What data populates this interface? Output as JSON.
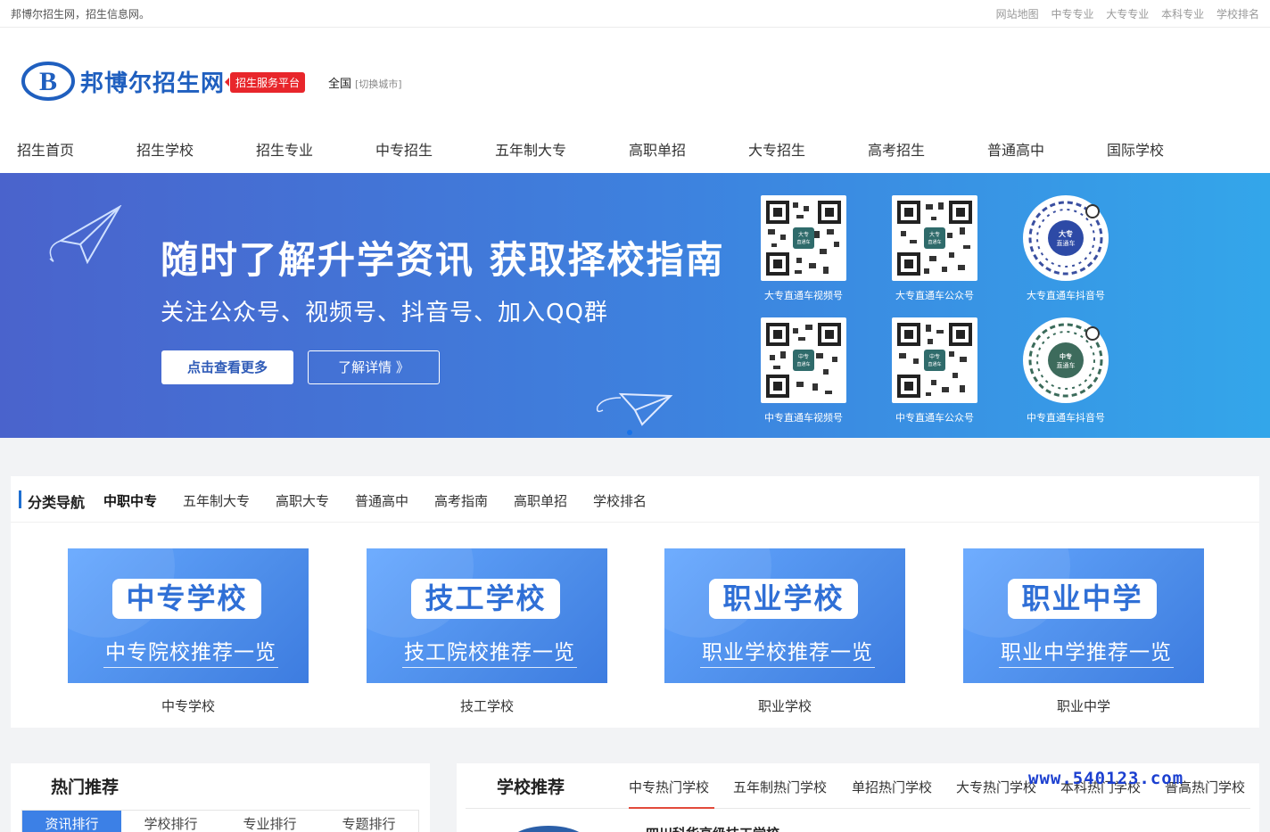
{
  "topbar": {
    "slogan": "邦博尔招生网，招生信息网。",
    "links": [
      "网站地图",
      "中专专业",
      "大专专业",
      "本科专业",
      "学校排名"
    ]
  },
  "header": {
    "logo_letter": "B",
    "logo_text": "邦博尔招生网",
    "tag": "招生服务平台",
    "city": "全国",
    "city_switch": "[切换城市]"
  },
  "nav": [
    "招生首页",
    "招生学校",
    "招生专业",
    "中专招生",
    "五年制大专",
    "高职单招",
    "大专招生",
    "高考招生",
    "普通高中",
    "国际学校"
  ],
  "banner": {
    "headline": "随时了解升学资讯 获取择校指南",
    "subline": "关注公众号、视频号、抖音号、加入QQ群",
    "btn_more": "点击查看更多",
    "btn_detail": "了解详情 》",
    "qr": [
      {
        "caption": "大专直通车视频号",
        "center": "大专\n直通车"
      },
      {
        "caption": "大专直通车公众号",
        "center": "大专\n直通车"
      },
      {
        "caption": "大专直通车抖音号",
        "center": "大专直通车"
      },
      {
        "caption": "中专直通车视频号",
        "center": "中专\n直通车"
      },
      {
        "caption": "中专直通车公众号",
        "center": "中专\n直通车"
      },
      {
        "caption": "中专直通车抖音号",
        "center": "中专直通车"
      }
    ]
  },
  "category": {
    "title": "分类导航",
    "tabs": [
      "中职中专",
      "五年制大专",
      "高职大专",
      "普通高中",
      "高考指南",
      "高职单招",
      "学校排名"
    ],
    "cards": [
      {
        "pill": "中专学校",
        "sub": "中专院校推荐一览",
        "label": "中专学校"
      },
      {
        "pill": "技工学校",
        "sub": "技工院校推荐一览",
        "label": "技工学校"
      },
      {
        "pill": "职业学校",
        "sub": "职业学校推荐一览",
        "label": "职业学校"
      },
      {
        "pill": "职业中学",
        "sub": "职业中学推荐一览",
        "label": "职业中学"
      }
    ]
  },
  "hot": {
    "title": "热门推荐",
    "tabs": [
      "资讯排行",
      "学校排行",
      "专业排行",
      "专题排行"
    ]
  },
  "schools": {
    "title": "学校推荐",
    "tabs": [
      "中专热门学校",
      "五年制热门学校",
      "单招热门学校",
      "大专热门学校",
      "本科热门学校",
      "普高热门学校"
    ],
    "first_row": "四川科华高级技工学校"
  },
  "watermark": "www.540123.com",
  "colors": {
    "brand_blue": "#1f5fbf",
    "tag_red": "#e8262b",
    "accent_tab": "#3c80e6",
    "underline_red": "#e24a3b"
  }
}
